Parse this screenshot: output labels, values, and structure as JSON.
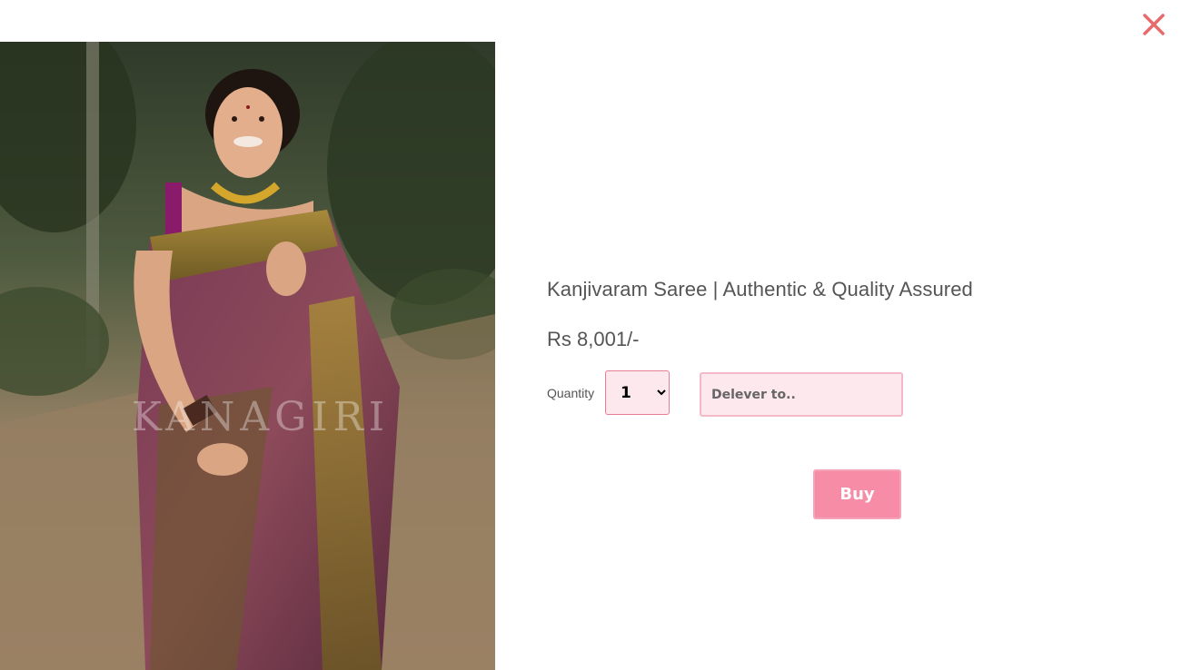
{
  "product": {
    "title": "Kanjivaram Saree | Authentic & Quality Assured",
    "price": "Rs 8,001/-",
    "image_alt": "Woman wearing a maroon and gold Kanjivaram silk saree",
    "watermark": "KANAGIRI"
  },
  "order": {
    "quantity_label": "Quantity",
    "quantity_value": "1",
    "deliver_placeholder": "Delever to..",
    "buy_label": "Buy"
  },
  "icons": {
    "close": "close-icon"
  },
  "colors": {
    "accent": "#f78ca6",
    "field_bg": "#fde8ee",
    "close": "#e86a6a"
  }
}
